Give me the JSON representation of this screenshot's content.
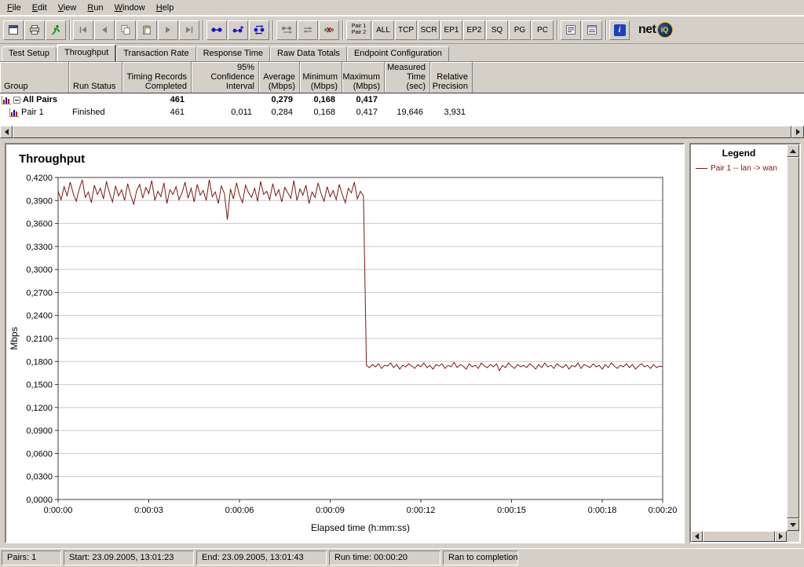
{
  "menu": {
    "items": [
      "File",
      "Edit",
      "View",
      "Run",
      "Window",
      "Help"
    ]
  },
  "toolbar": {
    "icon_buttons": [
      "report-icon",
      "print-icon",
      "run-test-icon",
      "first-pair-icon",
      "previous-pair-icon",
      "copy-icon",
      "paste-icon",
      "next-pair-icon",
      "last-pair-icon",
      "add-pair-icon",
      "add-group-icon",
      "swap-endpoints-icon",
      "replicate-pair-icon",
      "reverse-pair-icon",
      "delete-pair-icon",
      "list-view-icon",
      "details-view-icon",
      "info-icon",
      "netiq-logo"
    ],
    "pair_toggle": "Pair 1\nPair 2",
    "filter_buttons": [
      "ALL",
      "TCP",
      "SCR",
      "EP1",
      "EP2",
      "SQ",
      "PG",
      "PC"
    ],
    "info_glyph": "i",
    "logo": {
      "net": "net",
      "iq": "iQ"
    }
  },
  "tabs": {
    "items": [
      "Test Setup",
      "Throughput",
      "Transaction Rate",
      "Response Time",
      "Raw Data Totals",
      "Endpoint Configuration"
    ],
    "active": "Throughput"
  },
  "table": {
    "columns": [
      "Group",
      "Run Status",
      "Timing Records\nCompleted",
      "95% Confidence\nInterval",
      "Average\n(Mbps)",
      "Minimum\n(Mbps)",
      "Maximum\n(Mbps)",
      "Measured\nTime (sec)",
      "Relative\nPrecision"
    ],
    "rows": [
      {
        "group": "All Pairs",
        "run_status": "",
        "timing_records": "461",
        "confidence_interval": "",
        "average": "0,279",
        "minimum": "0,168",
        "maximum": "0,417",
        "measured_time": "",
        "relative_precision": ""
      },
      {
        "group": "Pair 1",
        "run_status": "Finished",
        "timing_records": "461",
        "confidence_interval": "0,011",
        "average": "0,284",
        "minimum": "0,168",
        "maximum": "0,417",
        "measured_time": "19,646",
        "relative_precision": "3,931"
      }
    ]
  },
  "chart_data": {
    "type": "line",
    "title": "Throughput",
    "xlabel": "Elapsed time (h:mm:ss)",
    "ylabel": "Mbps",
    "xlim": [
      0,
      20
    ],
    "ylim": [
      0,
      0.42
    ],
    "grid": "horizontal",
    "legend_position": "right-panel",
    "y_ticks": [
      {
        "v": 0.42,
        "label": "0,4200"
      },
      {
        "v": 0.39,
        "label": "0,3900"
      },
      {
        "v": 0.36,
        "label": "0,3600"
      },
      {
        "v": 0.33,
        "label": "0,3300"
      },
      {
        "v": 0.3,
        "label": "0,3000"
      },
      {
        "v": 0.27,
        "label": "0,2700"
      },
      {
        "v": 0.24,
        "label": "0,2400"
      },
      {
        "v": 0.21,
        "label": "0,2100"
      },
      {
        "v": 0.18,
        "label": "0,1800"
      },
      {
        "v": 0.15,
        "label": "0,1500"
      },
      {
        "v": 0.12,
        "label": "0,1200"
      },
      {
        "v": 0.09,
        "label": "0,0900"
      },
      {
        "v": 0.06,
        "label": "0,0600"
      },
      {
        "v": 0.03,
        "label": "0,0300"
      },
      {
        "v": 0.0,
        "label": "0,0000"
      }
    ],
    "x_ticks": [
      {
        "v": 0,
        "label": "0:00:00"
      },
      {
        "v": 3,
        "label": "0:00:03"
      },
      {
        "v": 6,
        "label": "0:00:06"
      },
      {
        "v": 9,
        "label": "0:00:09"
      },
      {
        "v": 12,
        "label": "0:00:12"
      },
      {
        "v": 15,
        "label": "0:00:15"
      },
      {
        "v": 18,
        "label": "0:00:18"
      },
      {
        "v": 20,
        "label": "0:00:20"
      }
    ],
    "series": [
      {
        "name": "Pair 1 -- lan -> wan",
        "color": "#7d1616",
        "x_start": 0,
        "x_step": 0.1,
        "values": [
          0.402,
          0.391,
          0.408,
          0.396,
          0.414,
          0.399,
          0.389,
          0.405,
          0.417,
          0.394,
          0.401,
          0.387,
          0.41,
          0.398,
          0.406,
          0.392,
          0.415,
          0.4,
          0.388,
          0.409,
          0.396,
          0.404,
          0.39,
          0.412,
          0.397,
          0.385,
          0.403,
          0.411,
          0.393,
          0.407,
          0.399,
          0.416,
          0.39,
          0.402,
          0.395,
          0.413,
          0.386,
          0.404,
          0.398,
          0.408,
          0.391,
          0.4,
          0.414,
          0.393,
          0.406,
          0.388,
          0.411,
          0.397,
          0.403,
          0.39,
          0.417,
          0.395,
          0.401,
          0.386,
          0.409,
          0.399,
          0.365,
          0.405,
          0.392,
          0.413,
          0.397,
          0.387,
          0.41,
          0.4,
          0.394,
          0.406,
          0.389,
          0.415,
          0.398,
          0.402,
          0.391,
          0.412,
          0.396,
          0.404,
          0.388,
          0.407,
          0.4,
          0.393,
          0.416,
          0.39,
          0.405,
          0.397,
          0.41,
          0.386,
          0.401,
          0.394,
          0.413,
          0.399,
          0.389,
          0.408,
          0.395,
          0.403,
          0.391,
          0.411,
          0.398,
          0.387,
          0.406,
          0.4,
          0.414,
          0.392,
          0.402,
          0.396,
          0.175,
          0.172,
          0.176,
          0.173,
          0.177,
          0.171,
          0.175,
          0.174,
          0.178,
          0.172,
          0.176,
          0.17,
          0.175,
          0.173,
          0.177,
          0.174,
          0.171,
          0.176,
          0.173,
          0.178,
          0.172,
          0.175,
          0.17,
          0.176,
          0.174,
          0.177,
          0.171,
          0.175,
          0.173,
          0.179,
          0.172,
          0.176,
          0.174,
          0.17,
          0.177,
          0.173,
          0.175,
          0.171,
          0.178,
          0.174,
          0.172,
          0.176,
          0.173,
          0.177,
          0.168,
          0.175,
          0.172,
          0.178,
          0.174,
          0.171,
          0.176,
          0.173,
          0.175,
          0.172,
          0.177,
          0.174,
          0.17,
          0.176,
          0.172,
          0.178,
          0.173,
          0.175,
          0.171,
          0.177,
          0.174,
          0.172,
          0.176,
          0.17,
          0.175,
          0.173,
          0.178,
          0.171,
          0.176,
          0.174,
          0.172,
          0.177,
          0.173,
          0.175,
          0.17,
          0.176,
          0.172,
          0.178,
          0.174,
          0.171,
          0.175,
          0.173,
          0.177,
          0.172,
          0.176,
          0.17,
          0.174,
          0.177,
          0.173,
          0.175,
          0.171,
          0.176,
          0.172,
          0.174,
          0.173
        ]
      }
    ]
  },
  "legend": {
    "title": "Legend",
    "entries": [
      {
        "label": "Pair 1 -- lan -> wan",
        "color": "#7d1616"
      }
    ]
  },
  "status_bar": {
    "pairs": "Pairs: 1",
    "start": "Start: 23.09.2005, 13:01:23",
    "end": "End: 23.09.2005, 13:01:43",
    "run_time": "Run time: 00:00:20",
    "result": "Ran to completion"
  }
}
